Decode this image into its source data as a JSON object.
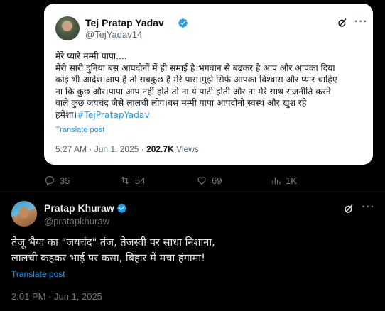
{
  "quoted_tweet": {
    "author_name": "Tej Pratap Yadav",
    "author_handle": "@TejYadav14",
    "text_lines": [
      "मेरे प्यारे मम्मी पापा....",
      "मेरी सारी दुनिया बस आपदोनों में ही समाई है।भगवान से बढ़कर है आप और आपका दिया",
      "कोई भी आदेश।आप है तो सबकुछ है मेरे पास।मुझे सिर्फ आपका विश्वास और प्यार चाहिए",
      "ना कि कुछ और।पापा आप नहीं होते तो ना ये पार्टी होती और ना मेरे साथ राजनीति करने",
      "वाले कुछ जयचंद जैसे लालची लोग।बस मम्मी पापा आपदोनो स्वस्थ और खुश रहे"
    ],
    "last_line_prefix": "हमेशा।",
    "hashtag": "#TejPratapYadav",
    "translate_label": "Translate post",
    "time": "5:27 AM · Jun 1, 2025 · ",
    "views_count": "202.7K",
    "views_label": " Views"
  },
  "actions": {
    "replies": "35",
    "reposts": "54",
    "likes": "69",
    "views": "1K"
  },
  "main_tweet": {
    "author_name": "Pratap Khuraw",
    "author_handle": "@pratapkhuraw",
    "text_lines": [
      "तेजू भैया का \"जयचंद\" तंज, तेजस्वी पर साधा निशाना,",
      "लालची कहकर भाई पर कसा, बिहार में मचा हंगामा!"
    ],
    "translate_label": "Translate post",
    "time": "2:01 PM · Jun 1, 2025"
  },
  "colors": {
    "background": "#000000",
    "card": "#ffffff",
    "accent": "#1d9bf0",
    "muted": "#71767b",
    "text": "#e7e9ea"
  },
  "icons": [
    "verified-badge-icon",
    "grok-icon",
    "more-icon",
    "reply-icon",
    "repost-icon",
    "like-icon",
    "views-icon"
  ]
}
